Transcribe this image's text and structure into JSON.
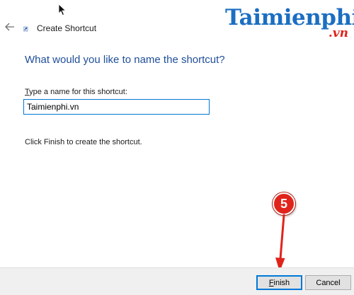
{
  "colors": {
    "heading": "#1f4e9b",
    "accent": "#0078d7",
    "brand_primary": "#1b6ec2",
    "brand_accent": "#e0241b",
    "badge": "#e0241b",
    "footer_bg": "#f0f0f0"
  },
  "nav": {
    "back_icon": "arrow-left-icon",
    "wizard_icon": "shortcut-wizard-icon",
    "title": "Create Shortcut"
  },
  "watermark": {
    "brand_prefix": "Taimienphi",
    "brand_suffix": ".vn"
  },
  "page": {
    "heading": "What would you like to name the shortcut?",
    "field_label_mnemonic": "T",
    "field_label_rest": "ype a name for this shortcut:",
    "field_value": "Taimienphi.vn",
    "instruction": "Click Finish to create the shortcut."
  },
  "annotation": {
    "step_number": "5"
  },
  "footer": {
    "finish_mnemonic": "F",
    "finish_rest": "inish",
    "cancel_label": "Cancel"
  }
}
